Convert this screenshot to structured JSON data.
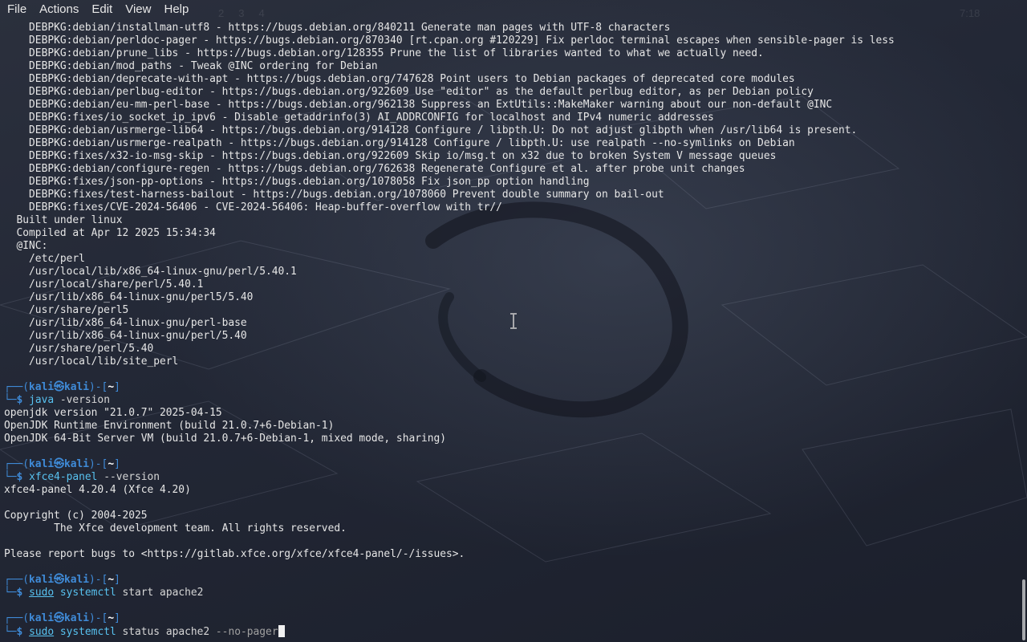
{
  "menubar": {
    "items": [
      "File",
      "Actions",
      "Edit",
      "View",
      "Help"
    ]
  },
  "panel_ghost": {
    "workspaces": [
      "2",
      "3",
      "4"
    ],
    "clock": "7:18"
  },
  "terminal": {
    "lines": [
      "    DEBPKG:debian/installman-utf8 - https://bugs.debian.org/840211 Generate man pages with UTF-8 characters",
      "    DEBPKG:debian/perldoc-pager - https://bugs.debian.org/870340 [rt.cpan.org #120229] Fix perldoc terminal escapes when sensible-pager is less",
      "    DEBPKG:debian/prune_libs - https://bugs.debian.org/128355 Prune the list of libraries wanted to what we actually need.",
      "    DEBPKG:debian/mod_paths - Tweak @INC ordering for Debian",
      "    DEBPKG:debian/deprecate-with-apt - https://bugs.debian.org/747628 Point users to Debian packages of deprecated core modules",
      "    DEBPKG:debian/perlbug-editor - https://bugs.debian.org/922609 Use \"editor\" as the default perlbug editor, as per Debian policy",
      "    DEBPKG:debian/eu-mm-perl-base - https://bugs.debian.org/962138 Suppress an ExtUtils::MakeMaker warning about our non-default @INC",
      "    DEBPKG:fixes/io_socket_ip_ipv6 - Disable getaddrinfo(3) AI_ADDRCONFIG for localhost and IPv4 numeric addresses",
      "    DEBPKG:debian/usrmerge-lib64 - https://bugs.debian.org/914128 Configure / libpth.U: Do not adjust glibpth when /usr/lib64 is present.",
      "    DEBPKG:debian/usrmerge-realpath - https://bugs.debian.org/914128 Configure / libpth.U: use realpath --no-symlinks on Debian",
      "    DEBPKG:fixes/x32-io-msg-skip - https://bugs.debian.org/922609 Skip io/msg.t on x32 due to broken System V message queues",
      "    DEBPKG:debian/configure-regen - https://bugs.debian.org/762638 Regenerate Configure et al. after probe unit changes",
      "    DEBPKG:fixes/json-pp-options - https://bugs.debian.org/1078058 Fix json_pp option handling",
      "    DEBPKG:fixes/test-harness-bailout - https://bugs.debian.org/1078060 Prevent double summary on bail-out",
      "    DEBPKG:fixes/CVE-2024-56406 - CVE-2024-56406: Heap-buffer-overflow with tr//",
      "  Built under linux",
      "  Compiled at Apr 12 2025 15:34:34",
      "  @INC:",
      "    /etc/perl",
      "    /usr/local/lib/x86_64-linux-gnu/perl/5.40.1",
      "    /usr/local/share/perl/5.40.1",
      "    /usr/lib/x86_64-linux-gnu/perl5/5.40",
      "    /usr/share/perl5",
      "    /usr/lib/x86_64-linux-gnu/perl-base",
      "    /usr/lib/x86_64-linux-gnu/perl/5.40",
      "    /usr/share/perl/5.40",
      "    /usr/local/lib/site_perl"
    ],
    "prompt": {
      "top_left": "┌──(",
      "user": "kali",
      "at": "㉿",
      "host": "kali",
      "mid": ")-[",
      "dir": "~",
      "end": "]",
      "bottom_left": "└─",
      "dollar": "$"
    },
    "blocks": [
      {
        "cmd": "java",
        "args": " -version",
        "output": [
          "openjdk version \"21.0.7\" 2025-04-15",
          "OpenJDK Runtime Environment (build 21.0.7+6-Debian-1)",
          "OpenJDK 64-Bit Server VM (build 21.0.7+6-Debian-1, mixed mode, sharing)",
          ""
        ]
      },
      {
        "cmd": "xfce4-panel",
        "args": " --version",
        "output": [
          "xfce4-panel 4.20.4 (Xfce 4.20)",
          "",
          "Copyright (c) 2004-2025",
          "        The Xfce development team. All rights reserved.",
          "",
          "Please report bugs to <https://gitlab.xfce.org/xfce/xfce4-panel/-/issues>.",
          ""
        ]
      },
      {
        "sudo": "sudo",
        "cmd": "systemctl",
        "args": " start apache2",
        "output": [
          ""
        ]
      },
      {
        "sudo": "sudo",
        "cmd": "systemctl",
        "args": " status apache2 ",
        "opt": "--no-pager",
        "output": []
      }
    ]
  }
}
